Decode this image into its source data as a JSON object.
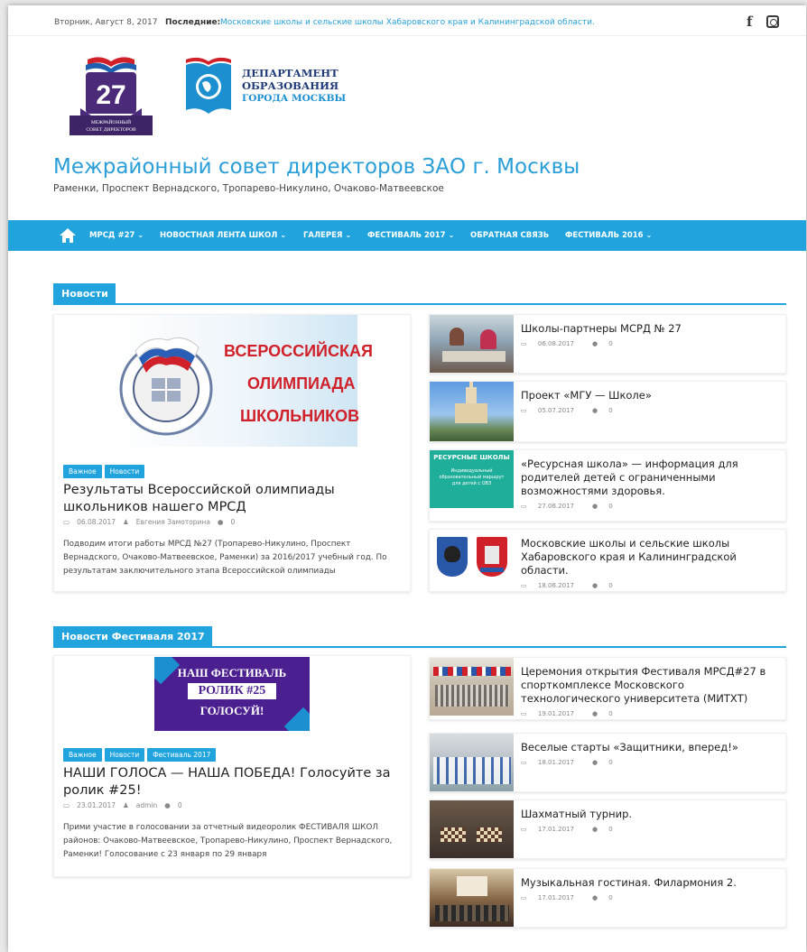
{
  "topbar": {
    "date": "Вторник, Август 8, 2017",
    "latest_label": "Последние:",
    "latest_link": "Московские школы и сельские школы Хабаровского края и Калининградской области.",
    "social": [
      "facebook-icon",
      "instagram-icon"
    ]
  },
  "logos": {
    "badge_number": "27",
    "badge_ribbon": "МЕЖРАЙОННЫЙ СОВЕТ ДИРЕКТОРОВ",
    "dept_line1": "ДЕПАРТАМЕНТ",
    "dept_line2": "ОБРАЗОВАНИЯ",
    "dept_line3": "ГОРОДА МОСКВЫ"
  },
  "site": {
    "title": "Межрайонный совет директоров ЗАО г. Москвы",
    "description": "Раменки, Проспект Вернадского, Тропарево-Никулино, Очаково-Матвеевское"
  },
  "nav": {
    "items": [
      {
        "label": "МРСД #27",
        "dropdown": true
      },
      {
        "label": "НОВОСТНАЯ ЛЕНТА ШКОЛ",
        "dropdown": true
      },
      {
        "label": "ГАЛЕРЕЯ",
        "dropdown": true
      },
      {
        "label": "ФЕСТИВАЛЬ 2017",
        "dropdown": true
      },
      {
        "label": "ОБРАТНАЯ СВЯЗЬ",
        "dropdown": false
      },
      {
        "label": "ФЕСТИВАЛЬ 2016",
        "dropdown": true
      }
    ],
    "chevron": "⌄"
  },
  "news": {
    "section_title": "Новости",
    "featured": {
      "banner_line1": "ВСЕРОССИЙСКАЯ",
      "banner_line2": "ОЛИМПИАДА",
      "banner_line3": "ШКОЛЬНИКОВ",
      "categories": [
        "Важное",
        "Новости"
      ],
      "title": "Результаты Всероссийской олимпиады школьников нашего МРСД",
      "date": "06.08.2017",
      "author": "Евгения Замоторина",
      "comments": "0",
      "excerpt": "Подводим итоги работы МРСД №27 (Тропарево-Никулино, Проспект Вернадского, Очаково-Матвеевское, Раменки) за 2016/2017 учебный год. По результатам заключительного этапа Всероссийской олимпиады"
    },
    "items": [
      {
        "title": "Школы-партнеры МСРД № 27",
        "date": "06.08.2017",
        "comments": "0"
      },
      {
        "title": "Проект «МГУ — Школе»",
        "date": "05.07.2017",
        "comments": "0"
      },
      {
        "title": "«Ресурсная школа» — информация для родителей детей с ограниченными возможностями здоровья.",
        "date": "27.06.2017",
        "comments": "0",
        "thumb_text1": "РЕСУРСНЫЕ ШКОЛЫ",
        "thumb_text2": "Индивидуальный образовательный маршрут для детей с ОВЗ"
      },
      {
        "title": "Московские школы и сельские школы Хабаровского края и Калининградской области.",
        "date": "18.06.2017",
        "comments": "0"
      }
    ]
  },
  "festival": {
    "section_title": "Новости Фестиваля 2017",
    "featured": {
      "banner_line1": "НАШ ФЕСТИВАЛЬ",
      "banner_line2": "РОЛИК #25",
      "banner_line3": "ГОЛОСУЙ!",
      "categories": [
        "Важное",
        "Новости",
        "Фестиваль 2017"
      ],
      "title": "НАШИ ГОЛОСА — НАША ПОБЕДА! Голосуйте за ролик #25!",
      "date": "23.01.2017",
      "author": "admin",
      "comments": "0",
      "excerpt": "Прими участие в голосовании за отчетный видеоролик ФЕСТИВАЛЯ ШКОЛ районов: Очаково-Матвеевское, Тропарево-Никулино, Проспект Вернадского, Раменки! Голосование с 23 января по 29 января"
    },
    "items": [
      {
        "title": "Церемония открытия Фестиваля МРСД#27 в спорткомплексе Московского технологического университета (МИТХТ)",
        "date": "19.01.2017",
        "comments": "0"
      },
      {
        "title": "Веселые старты «Защитники, вперед!»",
        "date": "18.01.2017",
        "comments": "0"
      },
      {
        "title": "Шахматный турнир.",
        "date": "17.01.2017",
        "comments": "0"
      },
      {
        "title": "Музыкальная гостиная. Филармония 2.",
        "date": "17.01.2017",
        "comments": "0"
      }
    ]
  },
  "colors": {
    "accent": "#21a4dd",
    "title": "#2a9ed8",
    "banner_red": "#d0202a",
    "banner_purple": "#4b1f8f"
  }
}
